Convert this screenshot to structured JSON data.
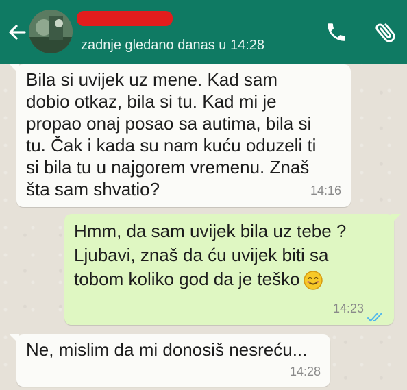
{
  "header": {
    "status": "zadnje gledano danas u 14:28"
  },
  "messages": [
    {
      "direction": "incoming",
      "text": "Bila si uvijek uz mene. Kad sam\ndobio otkaz, bila si tu. Kad mi je\npropao onaj posao sa autima, bila si\ntu. Čak i kada su nam kuću oduzeli ti\nsi bila tu u najgorem vremenu. Znaš\nšta sam shvatio?",
      "time": "14:16"
    },
    {
      "direction": "outgoing",
      "text": "Hmm, da sam uvijek bila uz tebe ?\nLjubavi, znaš da ću uvijek biti sa\ntobom koliko god da je teško",
      "emoji": "smiling-face-icon",
      "time": "14:23",
      "ticks": "double-check-icon"
    },
    {
      "direction": "incoming",
      "text": "Ne, mislim da mi donosiš nesreću...",
      "time": "14:28"
    }
  ],
  "colors": {
    "header": "#0f7a63",
    "incoming_bubble": "#fbfbf8",
    "outgoing_bubble": "#dff7c2",
    "read_ticks": "#4fb6ec",
    "redaction": "#e21d1d"
  }
}
